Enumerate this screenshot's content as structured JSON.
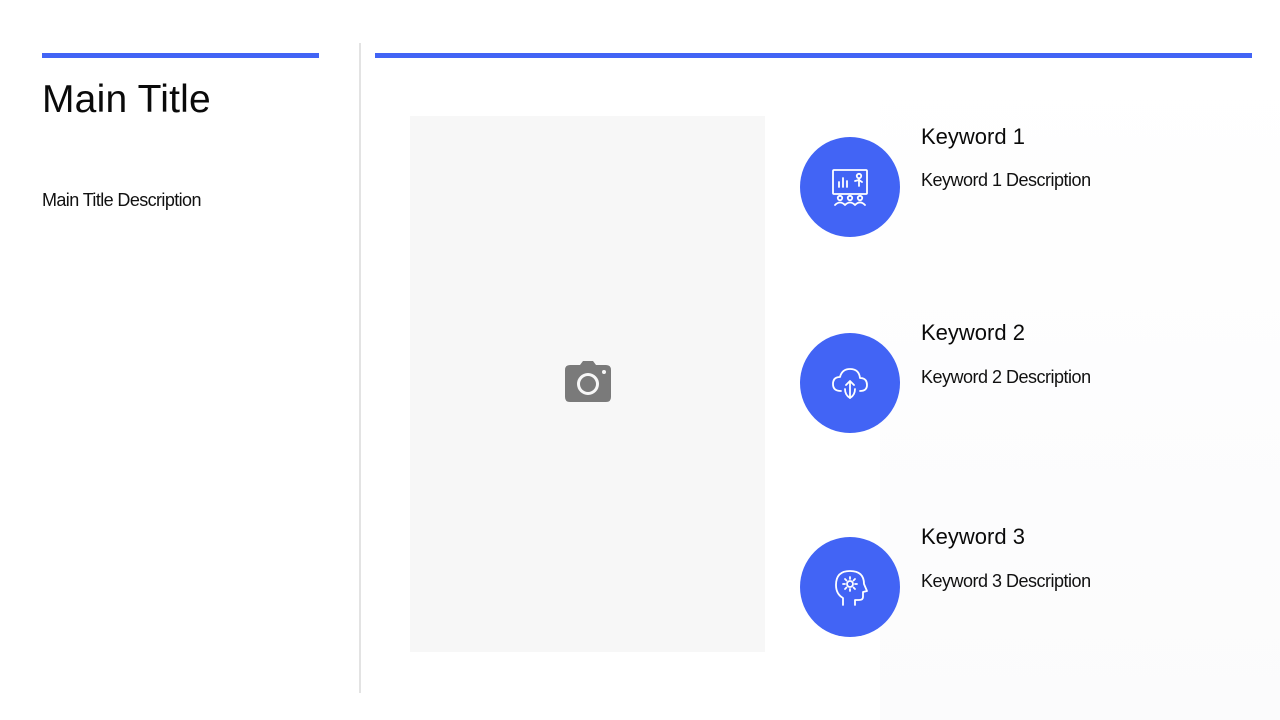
{
  "slide": {
    "title": "Main Title",
    "description": "Main Title Description",
    "accent_color": "#4264f5",
    "image_placeholder": {
      "icon": "camera-icon",
      "background": "#f7f7f7"
    },
    "keywords": [
      {
        "title": "Keyword 1",
        "description": "Keyword 1 Description",
        "icon": "presentation-board-icon"
      },
      {
        "title": "Keyword 2",
        "description": "Keyword 2 Description",
        "icon": "cloud-sync-icon"
      },
      {
        "title": "Keyword 3",
        "description": "Keyword 3 Description",
        "icon": "head-gear-icon"
      }
    ]
  }
}
